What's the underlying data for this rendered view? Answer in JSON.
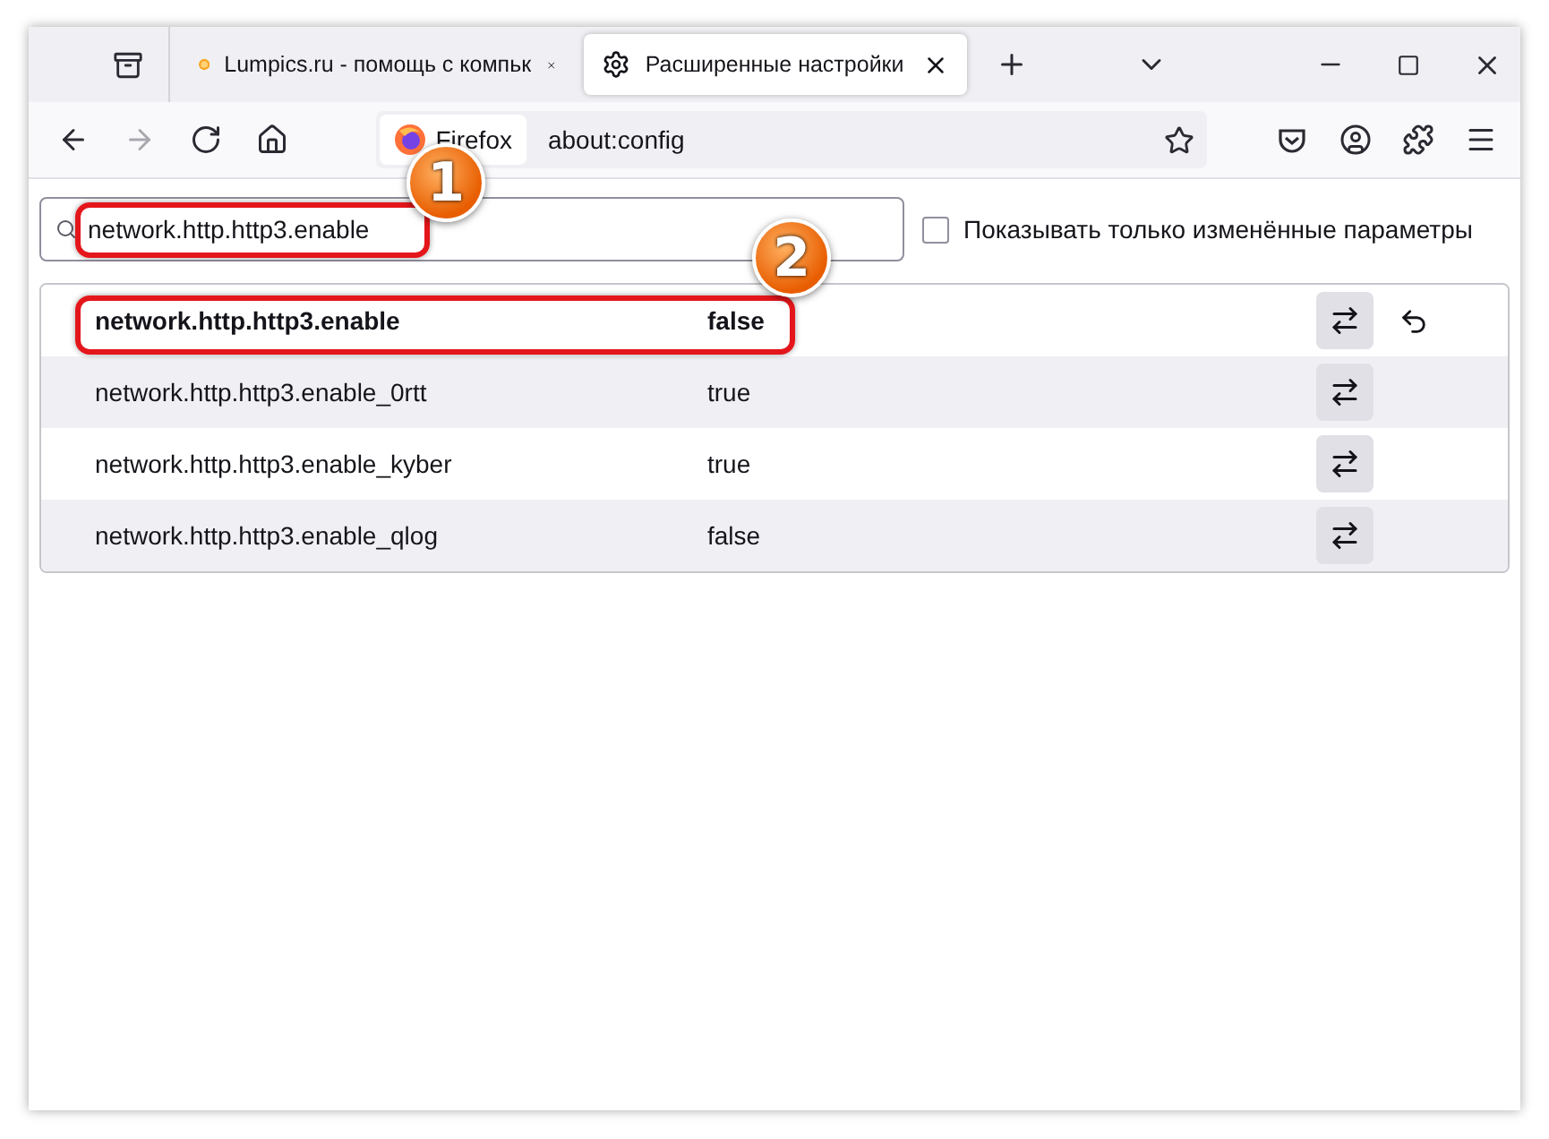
{
  "tabs": [
    {
      "title": "Lumpics.ru - помощь с компьк",
      "selected": false,
      "kind": "site"
    },
    {
      "title": "Расширенные настройки",
      "selected": true,
      "kind": "settings"
    }
  ],
  "nav_buttons": [
    {
      "kind": "back",
      "disabled": false
    },
    {
      "kind": "forward",
      "disabled": true
    },
    {
      "kind": "reload",
      "disabled": false
    },
    {
      "kind": "home",
      "disabled": false
    }
  ],
  "address_bar": {
    "identity": "Firefox",
    "url": "about:config"
  },
  "search": {
    "value": "network.http.http3.enable"
  },
  "filter": {
    "label": "Показывать только изменённые параметры",
    "checked": false
  },
  "prefs": [
    {
      "name": "network.http.http3.enable",
      "value": "false",
      "modified": true
    },
    {
      "name": "network.http.http3.enable_0rtt",
      "value": "true",
      "modified": false
    },
    {
      "name": "network.http.http3.enable_kyber",
      "value": "true",
      "modified": false
    },
    {
      "name": "network.http.http3.enable_qlog",
      "value": "false",
      "modified": false
    }
  ],
  "annotations": [
    {
      "number": "1"
    },
    {
      "number": "2"
    }
  ]
}
